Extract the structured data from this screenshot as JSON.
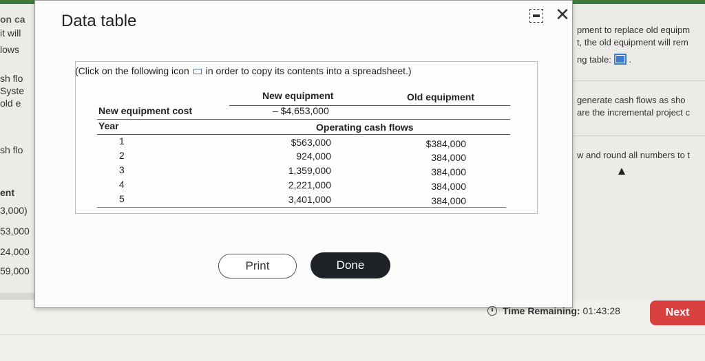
{
  "background_left": [
    "on ca",
    "it will",
    "lows",
    "sh flo",
    "Syste",
    "old e",
    "sh flo",
    "ent",
    "3,000)",
    "53,000",
    "24,000",
    "59,000"
  ],
  "background_right": {
    "line1": "pment to replace old equipm",
    "line2": "t, the old equipment will rem",
    "line3": "ng table:",
    "line4": "generate cash flows as sho",
    "line5": "are the incremental project c",
    "line6": "w and round all numbers to t"
  },
  "modal": {
    "title": "Data table",
    "instruction_before": "(Click on the following icon",
    "instruction_after": "in order to copy its contents into a spreadsheet.)",
    "headers": {
      "new_equipment": "New equipment",
      "old_equipment": "Old equipment",
      "new_equipment_cost_label": "New equipment cost",
      "new_equipment_cost_value": "– $4,653,000",
      "year": "Year",
      "operating_cash_flows": "Operating cash flows"
    },
    "rows": [
      {
        "year": "1",
        "new": "$563,000",
        "old": "$384,000"
      },
      {
        "year": "2",
        "new": "924,000",
        "old": "384,000"
      },
      {
        "year": "3",
        "new": "1,359,000",
        "old": "384,000"
      },
      {
        "year": "4",
        "new": "2,221,000",
        "old": "384,000"
      },
      {
        "year": "5",
        "new": "3,401,000",
        "old": "384,000"
      }
    ],
    "print_label": "Print",
    "done_label": "Done"
  },
  "footer": {
    "timer_label": "Time Remaining:",
    "timer_value": "01:43:28",
    "next_label": "Next"
  }
}
